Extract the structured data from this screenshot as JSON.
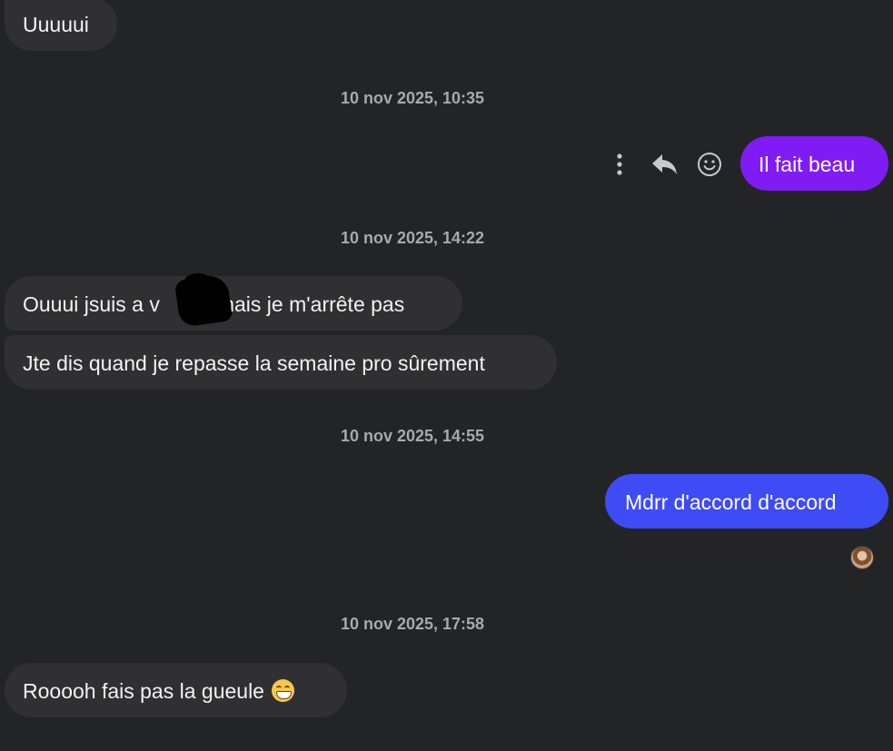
{
  "messages": {
    "m1": "Uuuuui",
    "m2": "Il fait beau",
    "m3_part1": "Ouuui jsuis a v",
    "m3_part2": "mais je m'arrête pas",
    "m4": "Jte dis quand je repasse la semaine pro sûrement",
    "m5": "Mdrr d'accord d'accord",
    "m6": "Rooooh fais pas la gueule"
  },
  "timestamps": {
    "t1": "10 nov 2025, 10:35",
    "t2": "10 nov 2025, 14:22",
    "t3": "10 nov 2025, 14:55",
    "t4": "10 nov 2025, 17:58"
  },
  "icons": {
    "more": "vertical-dots",
    "reply": "reply-arrow",
    "react": "smiley",
    "emoji_in_message": "grinning-face"
  },
  "colors": {
    "background": "#232426",
    "incoming_bubble": "#303032",
    "outgoing_purple": "#7f1cf4",
    "outgoing_blue": "#3d4cf5",
    "timestamp": "#a8a9ad"
  }
}
